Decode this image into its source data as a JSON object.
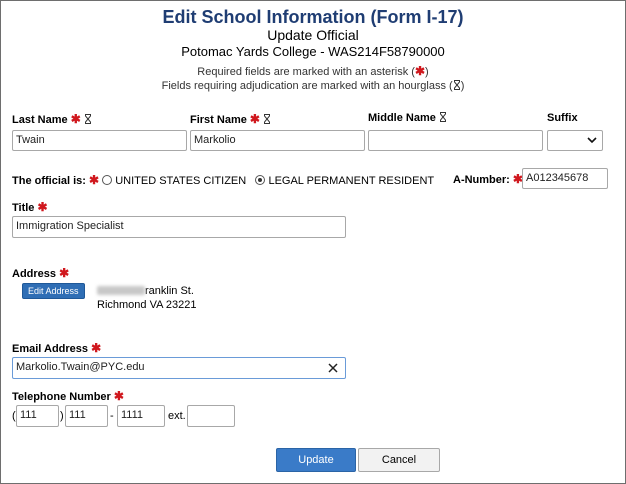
{
  "header": {
    "title": "Edit School Information (Form I-17)",
    "subtitle": "Update Official",
    "school": "Potomac Yards College - WAS214F58790000",
    "required_note_prefix": "Required fields are marked with an asterisk (",
    "required_note_suffix": ")",
    "adjudication_note_prefix": "Fields requiring adjudication are marked with an hourglass (",
    "adjudication_note_suffix": ")"
  },
  "name": {
    "last_label": "Last Name",
    "last_value": "Twain",
    "first_label": "First Name",
    "first_value": "Markolio",
    "middle_label": "Middle Name",
    "middle_value": "",
    "suffix_label": "Suffix",
    "suffix_value": ""
  },
  "status": {
    "label": "The official is:",
    "option1": "UNITED STATES CITIZEN",
    "option2": "LEGAL PERMANENT RESIDENT",
    "selected": "option2",
    "anumber_label": "A-Number:",
    "anumber_value": "A012345678"
  },
  "title_field": {
    "label": "Title",
    "value": "Immigration Specialist"
  },
  "address": {
    "label": "Address",
    "edit_button": "Edit Address",
    "line1_visible": "ranklin St.",
    "line2": "Richmond VA 23221"
  },
  "email": {
    "label": "Email Address",
    "value": "Markolio.Twain@PYC.edu"
  },
  "phone": {
    "label": "Telephone Number",
    "open_paren": "(",
    "area": "111",
    "close_paren": ")",
    "prefix": "111",
    "dash": "-",
    "line": "1111",
    "ext_label": "ext.",
    "ext_value": ""
  },
  "actions": {
    "update": "Update",
    "cancel": "Cancel"
  },
  "colors": {
    "title": "#1f3d73",
    "required": "#d0181e",
    "primary_button": "#3a7bc8",
    "edit_button": "#2f6eb5"
  },
  "icons": {
    "required": "asterisk-icon",
    "adjudication": "hourglass-icon",
    "clear": "clear-x-icon",
    "dropdown": "chevron-down-icon"
  }
}
